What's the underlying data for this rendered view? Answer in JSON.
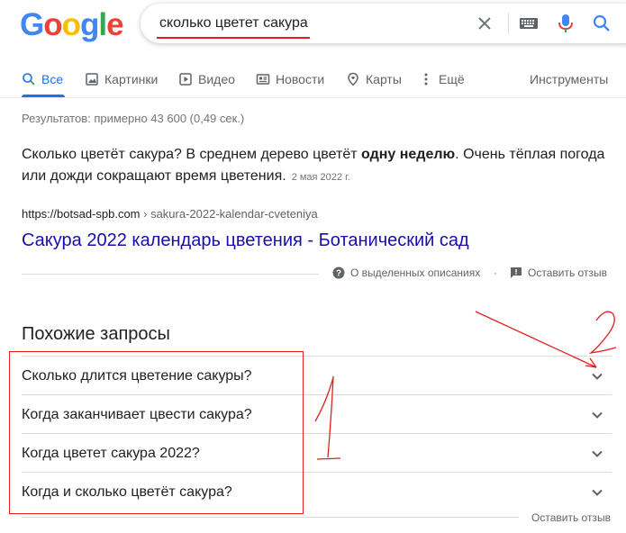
{
  "logo": {
    "letters": [
      "G",
      "o",
      "o",
      "g",
      "l",
      "e"
    ],
    "colors": [
      "#4285F4",
      "#EA4335",
      "#FBBC05",
      "#4285F4",
      "#34A853",
      "#EA4335"
    ]
  },
  "search": {
    "query": "сколько цветет сакура"
  },
  "tabs": [
    {
      "label": "Все",
      "icon": "search-icon",
      "active": true
    },
    {
      "label": "Картинки",
      "icon": "image-icon"
    },
    {
      "label": "Видео",
      "icon": "video-icon"
    },
    {
      "label": "Новости",
      "icon": "news-icon"
    },
    {
      "label": "Карты",
      "icon": "map-pin-icon"
    },
    {
      "label": "Ещё",
      "icon": "more-dots-icon"
    }
  ],
  "tools_label": "Инструменты",
  "result_stats": "Результатов: примерно 43 600 (0,49 сек.)",
  "snippet": {
    "text_before": "Сколько цветёт сакура? В среднем дерево цветёт ",
    "text_bold": "одну неделю",
    "text_after": ". Очень тёплая погода или дожди сокращают время цветения.",
    "date": "2 мая 2022 г.",
    "url_domain": "https://botsad-spb.com",
    "url_path": " › sakura-2022-kalendar-cveteniya",
    "title": "Сакура 2022 календарь цветения - Ботанический сад",
    "about_label": "О выделенных описаниях",
    "separator": "·",
    "feedback_label": "Оставить отзыв"
  },
  "related": {
    "title": "Похожие запросы",
    "questions": [
      "Сколько длится цветение сакуры?",
      "Когда заканчивает цвести сакура?",
      "Когда цветет сакура 2022?",
      "Когда и сколько цветёт сакура?"
    ],
    "feedback_label": "Оставить отзыв"
  },
  "annotations": {
    "color": "#e02020",
    "marks": [
      "1",
      "2"
    ]
  }
}
